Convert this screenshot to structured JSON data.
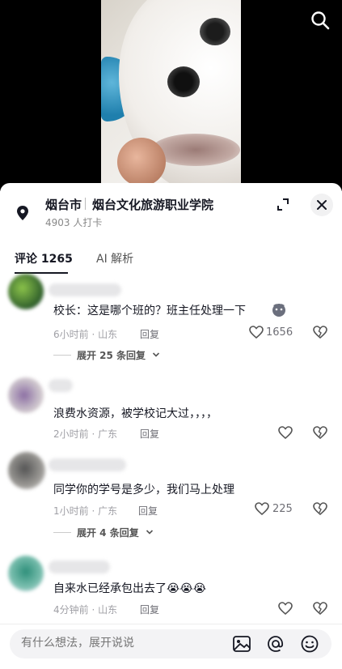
{
  "location": {
    "city": "烟台市",
    "place": "烟台文化旅游职业学院",
    "checkins": "4903 人打卡"
  },
  "tabs": [
    {
      "label": "评论 1265",
      "active": true
    },
    {
      "label": "AI 解析",
      "active": false
    }
  ],
  "comments": [
    {
      "text": "校长：这是哪个班的？班主任处理一下",
      "emoji": "cat-emoji",
      "meta": "6小时前 · 山东",
      "reply": "回复",
      "likes": "1656",
      "replies": "展开 25 条回复"
    },
    {
      "text": "浪费水资源，被学校记大过，，，，",
      "meta": "2小时前 · 广东",
      "reply": "回复",
      "likes": ""
    },
    {
      "text": "同学你的学号是多少，我们马上处理",
      "meta": "1小时前 · 广东",
      "reply": "回复",
      "likes": "225",
      "replies": "展开 4 条回复"
    },
    {
      "text": "自来水已经承包出去了😭😭😭",
      "meta": "4分钟前 · 山东",
      "reply": "回复",
      "likes": ""
    }
  ],
  "composer": {
    "placeholder": "有什么想法，展开说说"
  },
  "colors": {
    "text": "#161823",
    "muted": "#a0a0a6",
    "video_bg": "#000000",
    "composer_bg": "#f3f3f5"
  }
}
